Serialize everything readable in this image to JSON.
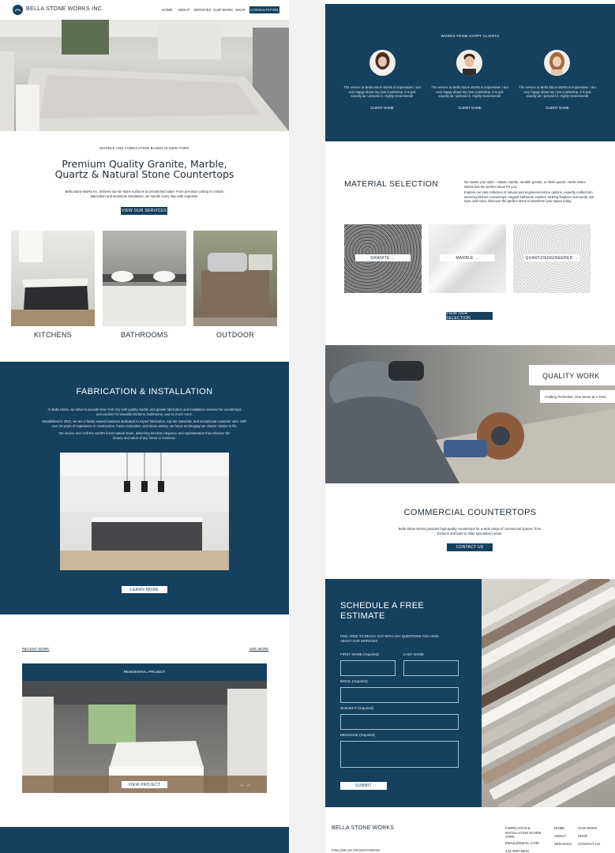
{
  "brand": {
    "name": "BELLA STONE WORKS INC.",
    "accent": "#15405e"
  },
  "nav": {
    "items": [
      "HOME",
      "ABOUT",
      "SERVICES",
      "OUR WORK",
      "SHOP"
    ],
    "cta": "CONSULTATION"
  },
  "hero": {
    "eyebrow": "MARBLE AND FABRICATION BASED IN NEW YORK",
    "title": "Premium Quality Granite, Marble, Quartz & Natural Stone Countertops",
    "text": "Bella Stone Works Inc. delivers top-tier stone surfaces at unmatched value. From precision cutting to custom fabrication and seamless installation, we handle every step with expertise.",
    "button": "VIEW OUR SERVICES"
  },
  "categories": [
    "KITCHENS",
    "BATHROOMS",
    "OUTDOOR"
  ],
  "fabrication": {
    "title": "FABRICATION & INSTALLATION",
    "p1": "At Bella Stone, we strive to provide New York City with quality marble and granite fabrication and installation services for countertops and vanities for beautiful kitchens, bathrooms, and so much more.",
    "p2": "Established in 2022, we are a family-owned business dedicated to expert fabrication, top-tier materials, and exceptional customer care. With over 40 years of experience in construction, home renovation, and stone artistry, we focus on bringing our clients' visions to life.",
    "p3": "We source and craft the world's finest natural stone, delivering timeless elegance and sophistication that enhance the beauty and value of any home or business.",
    "button": "LEARN MORE"
  },
  "recent": {
    "label": "RECENT WORK",
    "see_more": "SEE MORE",
    "project_title": "RESIDENTIAL PROJECT",
    "button": "VIEW PROJECT",
    "arrows": "←  →"
  },
  "testimonials": {
    "title": "WORDS FROM HAPPY CLIENTS",
    "items": [
      {
        "quote": "The service at Bella Stone Works is impressive! I am very happy about my new countertop. It is just exactly as I pictured it. Highly recommend!",
        "name": "CLIENT NAME"
      },
      {
        "quote": "The service at Bella Stone Works is impressive! I am very happy about my new countertop. It is just exactly as I pictured it. Highly recommend!",
        "name": "CLIENT NAME"
      },
      {
        "quote": "The service at Bella Stone Works is impressive! I am very happy about my new countertop. It is just exactly as I pictured it. Highly recommend!",
        "name": "CLIENT NAME"
      }
    ]
  },
  "materials": {
    "title": "MATERIAL SELECTION",
    "p1": "No matter your style—classic marble, durable granite, or sleek quartz—Bella Stone Works has the perfect stone for you.",
    "p2": "Explore our vast collection of natural and engineered stone options, expertly crafted into stunning kitchen countertops, elegant bathroom vanities, striking fireplace surrounds, bar tops, and more. Discover the perfect stone to transform your space today.",
    "items": [
      "GRANITE →",
      "MARBLE →",
      "QUARTZ/ENGINEERED →"
    ],
    "button": "VIEW OUR SELECTION"
  },
  "quality": {
    "title": "QUALITY WORK",
    "tagline_pre": "Crafting ",
    "tagline_em": "Perfection",
    "tagline_post": ", One Stone at a Time."
  },
  "commercial": {
    "title": "COMMERCIAL COUNTERTOPS",
    "text": "Bella Stone Works provides high-quality countertops for a wide range of commercial spaces, from kitchens and bars to other specialized areas.",
    "button": "CONTACT US"
  },
  "estimate": {
    "title": "SCHEDULE A FREE ESTIMATE",
    "subtitle": "FEEL FREE TO REACH OUT WITH ANY QUESTIONS YOU HAVE ABOUT OUR SERVICES.",
    "first_name": "FIRST NAME (required)",
    "last_name": "LAST NAME",
    "email": "EMAIL (required)",
    "subject": "SUBJECT (required)",
    "message": "MESSAGE (required)",
    "submit": "SUBMIT"
  },
  "footer": {
    "brand": "BELLA STONE WORKS",
    "instagram": "FOLLOW US ON INSTAGRAM",
    "info": "FABRICATION & INSTALLATION IN NEW YORK",
    "email": "EMAIL@EMAIL.COM",
    "phone": "123-4567-8910",
    "links1": [
      "HOME",
      "ABOUT",
      "SERVICES"
    ],
    "links2": [
      "OUR WORK",
      "SHOP",
      "CONTACT US"
    ]
  }
}
